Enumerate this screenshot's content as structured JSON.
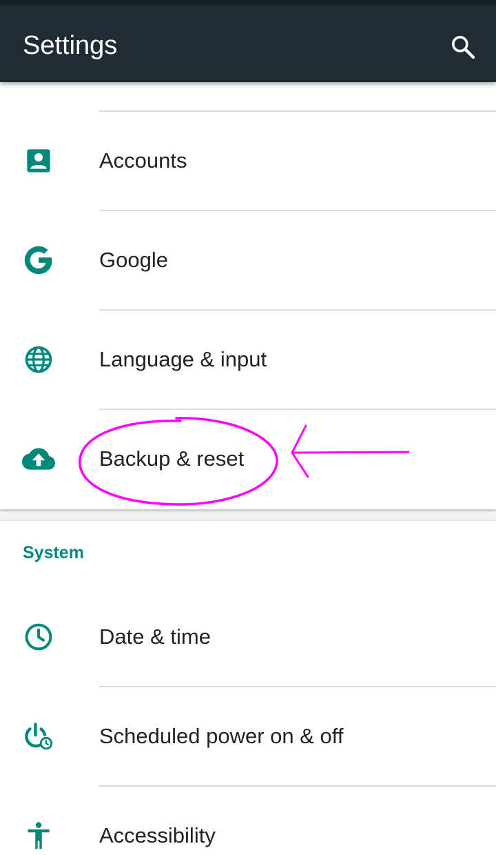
{
  "toolbar": {
    "title": "Settings",
    "search_icon": "search-icon"
  },
  "colors": {
    "toolbar_bg": "#212c32",
    "accent_teal": "#00897b",
    "annotation_magenta": "#ff00ff"
  },
  "personal_section": {
    "items": [
      {
        "label": "Accounts",
        "icon": "account-box-icon"
      },
      {
        "label": "Google",
        "icon": "google-g-icon"
      },
      {
        "label": "Language & input",
        "icon": "globe-icon"
      },
      {
        "label": "Backup & reset",
        "icon": "cloud-upload-icon"
      }
    ]
  },
  "system_section": {
    "header": "System",
    "items": [
      {
        "label": "Date & time",
        "icon": "clock-icon"
      },
      {
        "label": "Scheduled power on & off",
        "icon": "power-clock-icon"
      },
      {
        "label": "Accessibility",
        "icon": "accessibility-icon"
      }
    ]
  },
  "annotation": {
    "shapes": [
      "circle-highlight",
      "arrow-left"
    ]
  }
}
